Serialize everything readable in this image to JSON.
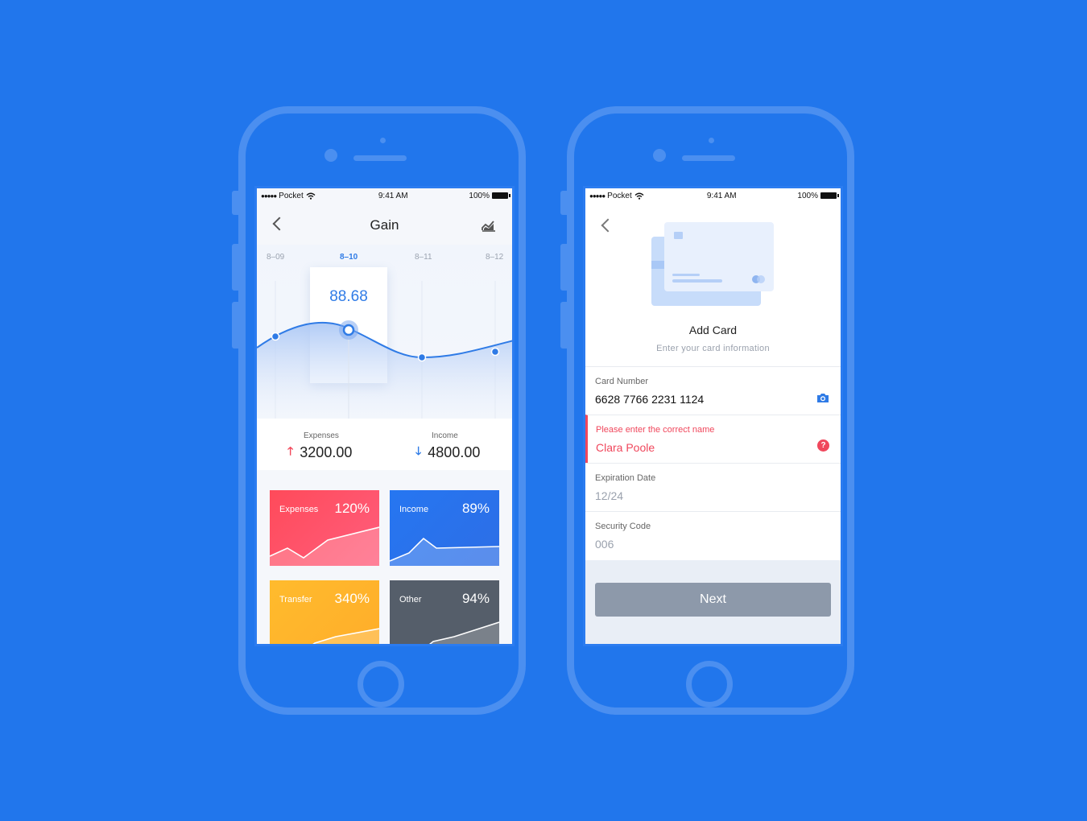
{
  "status_bar": {
    "signal": "●●●●●",
    "carrier": "Pocket",
    "time": "9:41 AM",
    "battery": "100%"
  },
  "gain_screen": {
    "title": "Gain",
    "dates": [
      "8–09",
      "8–10",
      "8–11",
      "8–12"
    ],
    "selected_value": "88.68",
    "expenses_label": "Expenses",
    "expenses_value": "3200.00",
    "income_label": "Income",
    "income_value": "4800.00",
    "tiles": [
      {
        "label": "Expenses",
        "percent": "120%"
      },
      {
        "label": "Income",
        "percent": "89%"
      },
      {
        "label": "Transfer",
        "percent": "340%"
      },
      {
        "label": "Other",
        "percent": "94%"
      }
    ]
  },
  "add_card_screen": {
    "title": "Add Card",
    "subtitle": "Enter your card information",
    "card_number_label": "Card Number",
    "card_number_value": "6628 7766 2231 1124",
    "name_error": "Please enter the correct name",
    "name_value": "Clara Poole",
    "expiration_label": "Expiration Date",
    "expiration_value": "12/24",
    "security_label": "Security Code",
    "security_value": "006",
    "next_label": "Next"
  },
  "colors": {
    "background": "#2176ec",
    "accent": "#2f7be6",
    "error": "#f0475c",
    "button_disabled": "#8d99aa"
  }
}
